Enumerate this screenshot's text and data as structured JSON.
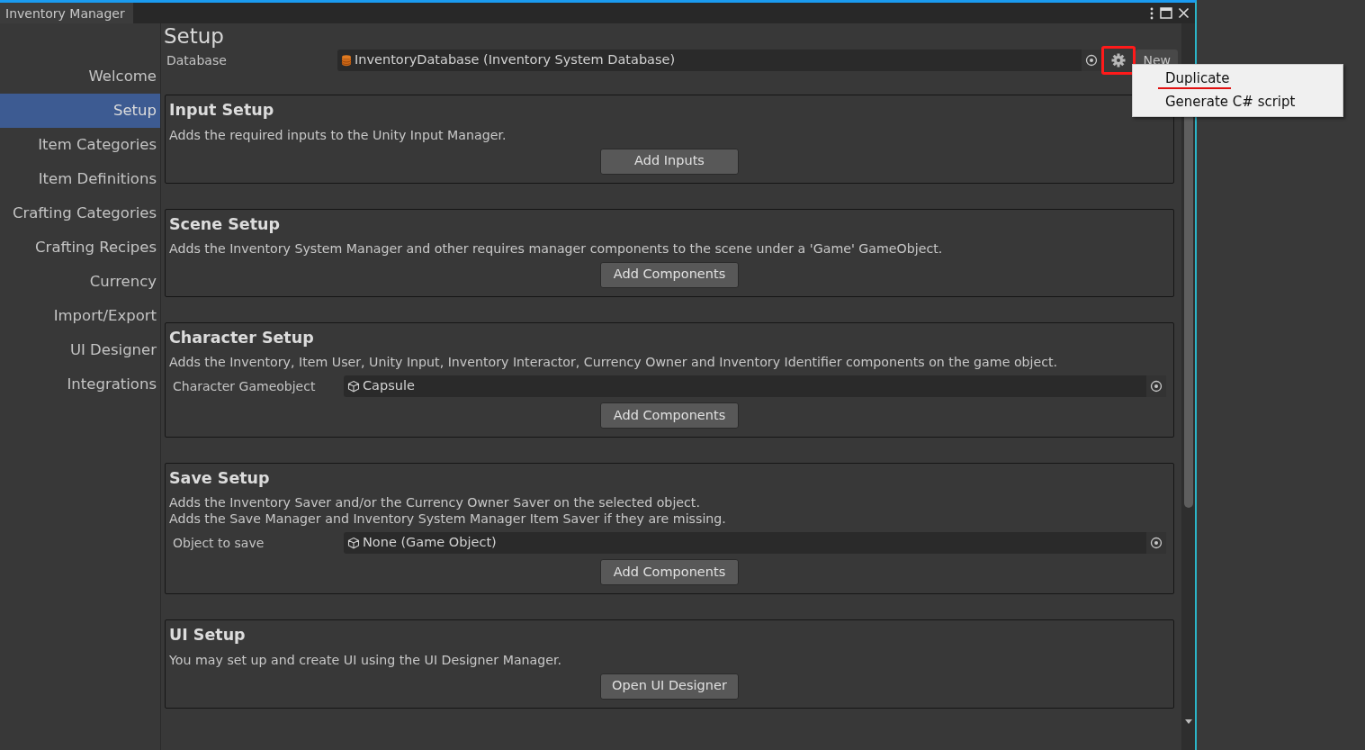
{
  "window": {
    "title": "Inventory Manager",
    "focused": true
  },
  "sidebar": {
    "items": [
      {
        "label": "Welcome",
        "selected": false
      },
      {
        "label": "Setup",
        "selected": true
      },
      {
        "label": "Item Categories",
        "selected": false
      },
      {
        "label": "Item Definitions",
        "selected": false
      },
      {
        "label": "Crafting Categories",
        "selected": false
      },
      {
        "label": "Crafting Recipes",
        "selected": false
      },
      {
        "label": "Currency",
        "selected": false
      },
      {
        "label": "Import/Export",
        "selected": false
      },
      {
        "label": "UI Designer",
        "selected": false
      },
      {
        "label": "Integrations",
        "selected": false
      }
    ]
  },
  "page": {
    "title": "Setup",
    "database": {
      "label": "Database",
      "value": "InventoryDatabase (Inventory System Database)",
      "new_button": "New",
      "gear_highlighted": true
    }
  },
  "context_menu": {
    "items": [
      {
        "label": "Duplicate",
        "underlined": true
      },
      {
        "label": "Generate C# script",
        "underlined": false
      }
    ]
  },
  "sections": [
    {
      "title": "Input Setup",
      "description": [
        "Adds the required inputs to the Unity Input Manager."
      ],
      "button": "Add Inputs"
    },
    {
      "title": "Scene Setup",
      "description": [
        "Adds the Inventory System Manager and other requires manager components to the scene under a 'Game' GameObject."
      ],
      "button": "Add Components"
    },
    {
      "title": "Character Setup",
      "description": [
        "Adds the Inventory, Item User, Unity Input, Inventory Interactor, Currency Owner and Inventory Identifier components on the game object."
      ],
      "field": {
        "label": "Character Gameobject",
        "value": "Capsule"
      },
      "button": "Add Components"
    },
    {
      "title": "Save Setup",
      "description": [
        "Adds the Inventory Saver and/or the Currency Owner Saver on the selected object.",
        "Adds the Save Manager and Inventory System Manager Item Saver if they are missing."
      ],
      "field": {
        "label": "Object to save",
        "value": "None (Game Object)"
      },
      "button": "Add Components"
    },
    {
      "title": "UI Setup",
      "description": [
        "You may set up and create UI using the UI Designer Manager."
      ],
      "button": "Open UI Designer"
    }
  ]
}
